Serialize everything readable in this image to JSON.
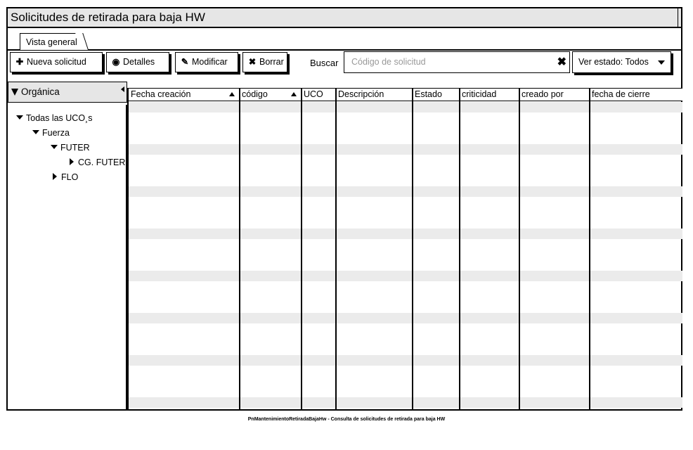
{
  "window": {
    "title": "Solicitudes de retirada para baja HW"
  },
  "tabs": [
    {
      "label": "Vista general"
    }
  ],
  "toolbar": {
    "new_label": "Nueva solicitud",
    "details_label": "Detalles",
    "edit_label": "Modificar",
    "delete_label": "Borrar",
    "search_label": "Buscar",
    "search_placeholder": "Código de solicitud",
    "state_select": "Ver estado: Todos"
  },
  "sidebar": {
    "header": "Orgánica",
    "tree": [
      {
        "label": "Todas las UCO¸s",
        "level": 0,
        "expanded": true
      },
      {
        "label": "Fuerza",
        "level": 1,
        "expanded": true
      },
      {
        "label": "FUTER",
        "level": 2,
        "expanded": true
      },
      {
        "label": "CG. FUTER",
        "level": 3,
        "expanded": false
      },
      {
        "label": "FLO",
        "level": 2,
        "expanded": false
      }
    ]
  },
  "table": {
    "columns": [
      {
        "label": "Fecha creación",
        "sortable": true
      },
      {
        "label": "código",
        "sortable": true
      },
      {
        "label": "UCO",
        "sortable": false
      },
      {
        "label": "Descripción",
        "sortable": false
      },
      {
        "label": "Estado",
        "sortable": false
      },
      {
        "label": "criticidad",
        "sortable": false
      },
      {
        "label": "creado por",
        "sortable": false
      },
      {
        "label": "fecha de cierre",
        "sortable": false
      }
    ]
  },
  "footer": {
    "caption": "PnMantenimientoRetiradaBajaHw - Consulta de solicitudes de retirada para baja HW"
  },
  "colors": {
    "header_bg": "#e6e6e6",
    "row_alt": "#ebebeb",
    "border": "#000000"
  }
}
